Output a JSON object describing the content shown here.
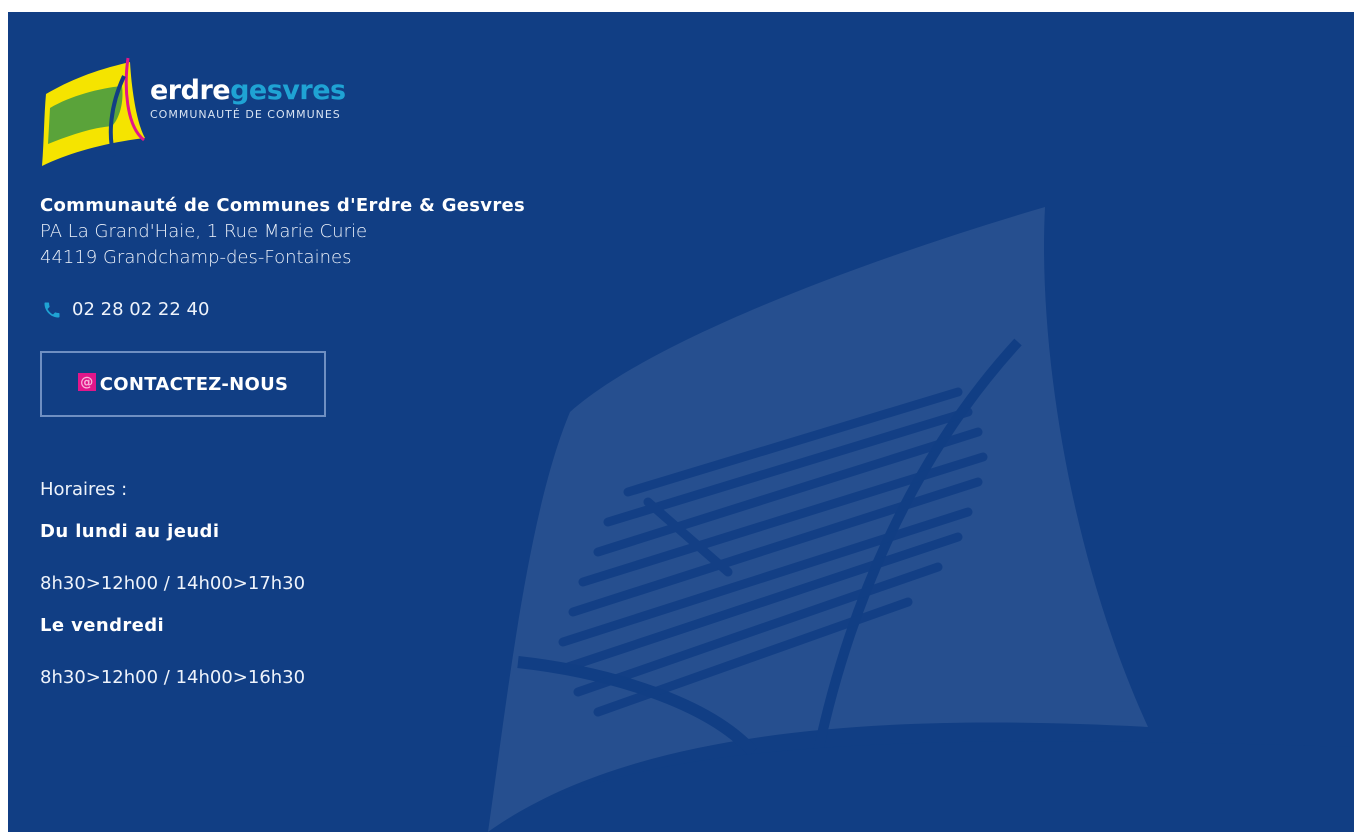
{
  "logo": {
    "name_part1": "erdre",
    "name_part2": "gesvres",
    "subtitle": "COMMUNAUTÉ DE COMMUNES"
  },
  "contact": {
    "org_name": "Communauté de Communes d'Erdre & Gesvres",
    "address_line1": "PA La Grand'Haie, 1 Rue Marie Curie",
    "address_line2": "44119 Grandchamp-des-Fontaines",
    "phone": "02 28 02 22 40",
    "contact_button": "CONTACTEZ-NOUS"
  },
  "hours": {
    "title": "Horaires :",
    "schedule": [
      {
        "day": "Du lundi au jeudi",
        "time": "8h30>12h00 / 14h00>17h30"
      },
      {
        "day": "Le vendredi",
        "time": "8h30>12h00 / 14h00>16h30"
      }
    ]
  },
  "icons": {
    "phone": "phone-icon",
    "contact": "at-sign-icon"
  },
  "colors": {
    "background": "#113e84",
    "accent_blue": "#1fa3d4",
    "accent_magenta": "#e2168a",
    "logo_yellow": "#f5e400",
    "logo_green": "#5aa33a"
  }
}
